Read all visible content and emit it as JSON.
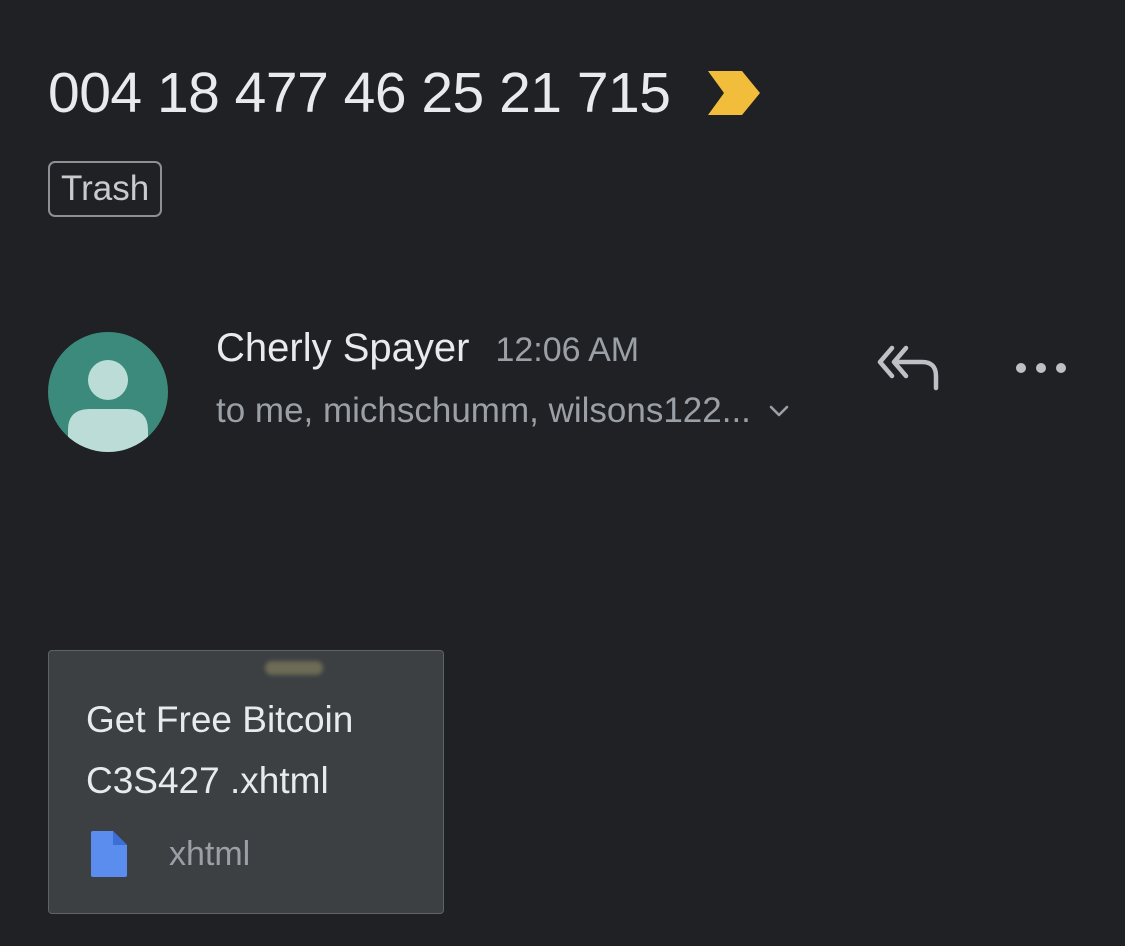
{
  "email": {
    "subject": "004 18 477 46 25 21 715",
    "label": "Trash",
    "important_marker_color": "#f2bd3a",
    "sender": {
      "name": "Cherly Spayer",
      "time": "12:06 AM",
      "recipients": "to me, michschumm, wilsons122..."
    },
    "actions": {
      "reply_all_icon": "reply-all-icon",
      "more_icon": "more-horizontal-icon"
    },
    "attachment": {
      "name": "Get Free Bitcoin C3S427 .xhtml",
      "type": "xhtml",
      "icon": "document-icon",
      "icon_color": "#5b8def"
    }
  },
  "colors": {
    "background": "#202124",
    "avatar_bg": "#3b8a7b",
    "avatar_fg": "#bcdcd8"
  }
}
